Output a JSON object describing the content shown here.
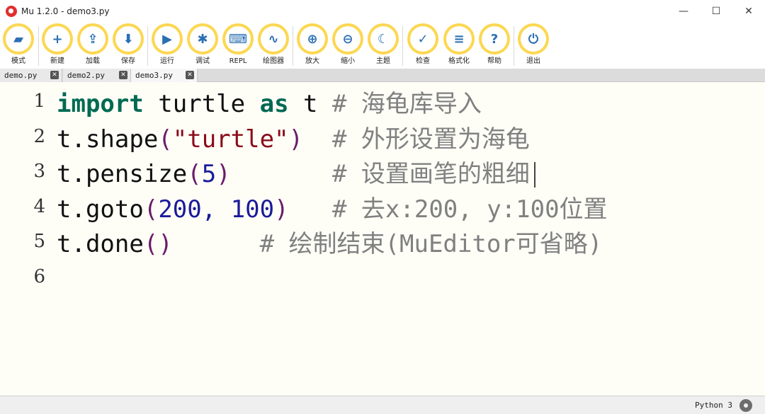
{
  "window": {
    "title": "Mu 1.2.0 - demo3.py",
    "minimize": "—",
    "maximize": "☐",
    "close": "✕"
  },
  "toolbar": {
    "buttons": [
      {
        "label": "模式",
        "icon": "mode-icon",
        "glyph": "▰"
      },
      {
        "label": "新建",
        "icon": "plus-icon",
        "glyph": "+"
      },
      {
        "label": "加载",
        "icon": "upload-icon",
        "glyph": "⇪"
      },
      {
        "label": "保存",
        "icon": "download-icon",
        "glyph": "⬇"
      },
      {
        "label": "运行",
        "icon": "play-icon",
        "glyph": "▶"
      },
      {
        "label": "调试",
        "icon": "bug-icon",
        "glyph": "✱"
      },
      {
        "label": "REPL",
        "icon": "keyboard-icon",
        "glyph": "⌨"
      },
      {
        "label": "绘图器",
        "icon": "pulse-icon",
        "glyph": "∿"
      },
      {
        "label": "放大",
        "icon": "zoom-in-icon",
        "glyph": "⊕"
      },
      {
        "label": "缩小",
        "icon": "zoom-out-icon",
        "glyph": "⊖"
      },
      {
        "label": "主题",
        "icon": "moon-icon",
        "glyph": "☾"
      },
      {
        "label": "检查",
        "icon": "thumbs-up-icon",
        "glyph": "✓"
      },
      {
        "label": "格式化",
        "icon": "lines-icon",
        "glyph": "≡"
      },
      {
        "label": "帮助",
        "icon": "question-icon",
        "glyph": "?"
      },
      {
        "label": "退出",
        "icon": "power-icon",
        "glyph": "⏻"
      }
    ]
  },
  "tabs": [
    {
      "label": "demo.py",
      "active": false
    },
    {
      "label": "demo2.py",
      "active": false
    },
    {
      "label": "demo3.py",
      "active": true
    }
  ],
  "editor": {
    "line_numbers": [
      "1",
      "2",
      "3",
      "4",
      "5",
      "6"
    ],
    "lines": [
      {
        "seg": [
          "import",
          " turtle ",
          "as",
          " t ",
          "# 海龟库导入"
        ]
      },
      {
        "seg": [
          "t.shape",
          "(",
          "\"turtle\"",
          ")",
          "  # 外形设置为海龟"
        ]
      },
      {
        "seg": [
          "t.pensize",
          "(",
          "5",
          ")",
          "       # 设置画笔的粗细"
        ]
      },
      {
        "seg": [
          "t.goto",
          "(",
          "200, 100",
          ")",
          "   # 去x:200, y:100位置"
        ]
      },
      {
        "seg": [
          "t.done",
          "()",
          "      # 绘制结束(MuEditor可省略)"
        ]
      }
    ]
  },
  "status": {
    "mode": "Python 3",
    "settings_icon": "gear-icon"
  },
  "colors": {
    "accent": "#fcd751",
    "icon": "#2b6fb3",
    "keyword": "#006a52",
    "string": "#8b0a1a",
    "comment": "#808080"
  }
}
